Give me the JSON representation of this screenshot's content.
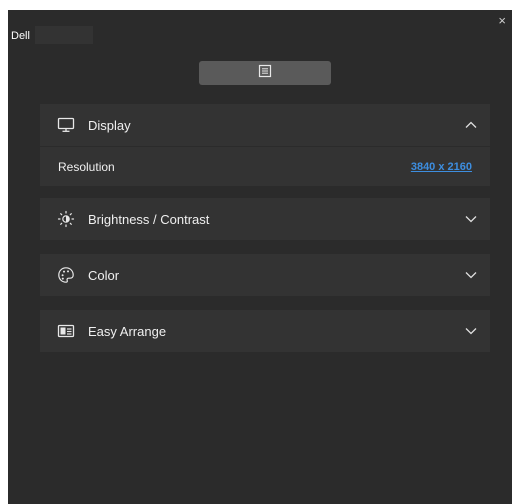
{
  "app": {
    "title": "Dell"
  },
  "window": {
    "close_label": "×"
  },
  "sections": [
    {
      "label": "Display",
      "icon": "monitor-icon",
      "expanded": true,
      "rows": [
        {
          "label": "Resolution",
          "value": "3840 x 2160"
        }
      ]
    },
    {
      "label": "Brightness / Contrast",
      "icon": "brightness-icon",
      "expanded": false
    },
    {
      "label": "Color",
      "icon": "palette-icon",
      "expanded": false
    },
    {
      "label": "Easy Arrange",
      "icon": "easy-arrange-icon",
      "expanded": false
    }
  ],
  "colors": {
    "background": "#2b2b2b",
    "panel": "#333333",
    "toolbar_button": "#5a5a5a",
    "link": "#3d8ee0"
  }
}
